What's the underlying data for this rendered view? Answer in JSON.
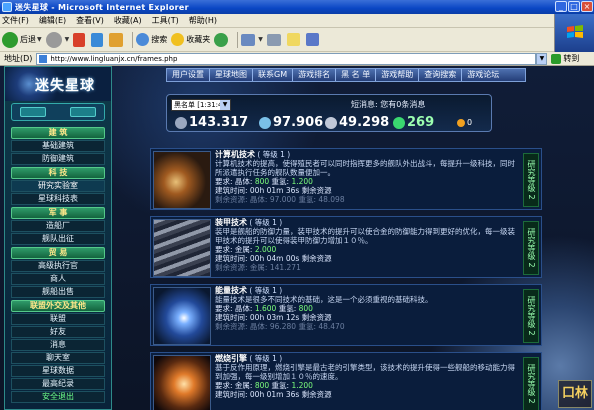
{
  "window": {
    "title": "迷失星球 - Microsoft Internet Explorer",
    "controls": [
      "_",
      "□",
      "×"
    ]
  },
  "menu": [
    "文件(F)",
    "编辑(E)",
    "查看(V)",
    "收藏(A)",
    "工具(T)",
    "帮助(H)"
  ],
  "toolbar": {
    "back": "后退",
    "search": "搜索",
    "favorites": "收藏夹"
  },
  "address": {
    "label": "地址(D)",
    "url": "http://www.lingluanjx.cn/frames.php",
    "go": "转到"
  },
  "sidebar": {
    "logo": "迷失星球",
    "sections": [
      {
        "title": "建 筑",
        "items": [
          "基础建筑",
          "防御建筑"
        ]
      },
      {
        "title": "科 技",
        "items": [
          "研究实验室",
          "星球科技表"
        ]
      },
      {
        "title": "军 事",
        "items": [
          "造船厂",
          "舰队出征"
        ]
      },
      {
        "title": "贸 易",
        "items": [
          "高级执行官",
          "商人",
          "舰船出售"
        ]
      },
      {
        "title": "联盟外交及其他",
        "items": [
          "联盟",
          "好友",
          "消息",
          "聊天室",
          "星球数据",
          "最高纪录",
          "安全退出"
        ]
      }
    ]
  },
  "topnav": [
    "用户设置",
    "星球地图",
    "联系GM",
    "游戏排名",
    "黑 名 单",
    "游戏帮助",
    "查询搜索",
    "游戏论坛"
  ],
  "planet_select": "黑名单 [1:31:4]",
  "message": "短消息: 您有0条消息",
  "resources": {
    "metal": "143.317",
    "crystal": "97.906",
    "deuterium": "49.298",
    "energy": "269",
    "other": "0"
  },
  "techs": [
    {
      "name": "计算机技术",
      "level": "( 等级 1 )",
      "desc": "计算机技术的提高，使得殖民者可以同时指挥更多的舰队外出战斗，每提升一级科技，同时所派遣执行任务的舰队数量便加一。",
      "req_label": "要求: 晶体:",
      "req_crystal": "800",
      "req_deut_label": "重氢:",
      "req_deut": "1.200",
      "time": "建筑时间: 00h 01m 36s 剩余资源",
      "remain": "剩余资源: 晶体: 97.000 重氢: 48.098",
      "status": "研究等级 2"
    },
    {
      "name": "装甲技术",
      "level": "( 等级 1 )",
      "desc": "装甲是舰船的防御力量，装甲技术的提升可以使合金的防御能力得到更好的优化，每一级装甲技术的提升可以使得装甲防御力增加１０％。",
      "req_label": "要求: 金属:",
      "req_crystal": "2.000",
      "req_deut_label": "",
      "req_deut": "",
      "time": "建筑时间: 00h 04m 00s 剩余资源",
      "remain": "剩余资源: 金属: 141.271",
      "status": "研究等级 2"
    },
    {
      "name": "能量技术",
      "level": "( 等级 1 )",
      "desc": "能量技术是很多不同技术的基础，这是一个必须重视的基础科技。",
      "req_label": "要求: 晶体:",
      "req_crystal": "1.600",
      "req_deut_label": "重氢:",
      "req_deut": "800",
      "time": "建筑时间: 00h 03m 12s 剩余资源",
      "remain": "剩余资源: 晶体: 96.280 重氢: 48.470",
      "status": "研究等级 2"
    },
    {
      "name": "燃烧引擎",
      "level": "( 等级 1 )",
      "desc": "基于反作用原理，燃烧引擎是最古老的引擎类型，该技术的提升使得一些舰船的移动能力得到加强，每一级别增加１０％的速度。",
      "req_label": "要求: 金属:",
      "req_crystal": "800",
      "req_deut_label": "重氢:",
      "req_deut": "1.200",
      "time": "建筑时间: 00h 01m 36s 剩余资源",
      "remain": "",
      "status": "研究等级 2"
    }
  ],
  "watermark": "口林"
}
